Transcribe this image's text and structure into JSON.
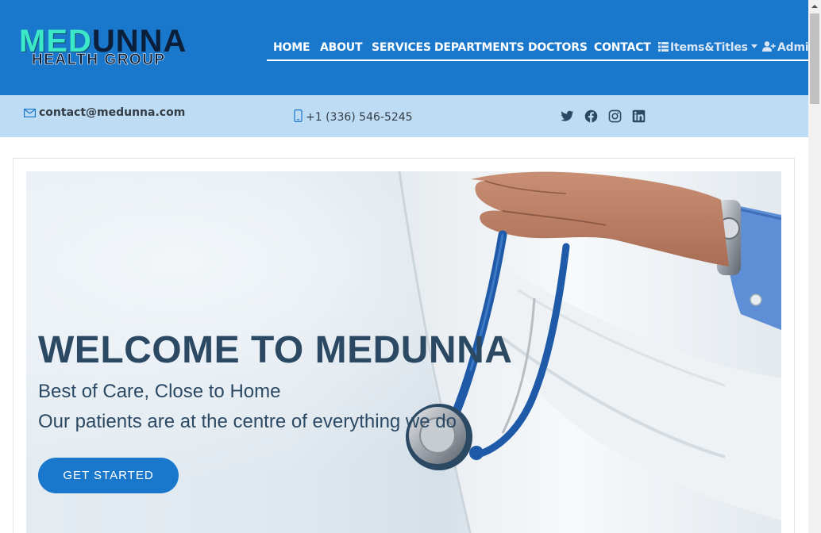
{
  "logo": {
    "line1_a": "MED",
    "line1_b": "UNNA",
    "line2": "HEALTH GROUP"
  },
  "nav": {
    "items": [
      {
        "label": "HOME"
      },
      {
        "label": "ABOUT"
      },
      {
        "label": "SERVICES"
      },
      {
        "label": "DEPARTMENTS"
      },
      {
        "label": "DOCTORS"
      },
      {
        "label": "CONTACT"
      }
    ],
    "dropdown_label": "Items&Titles",
    "dropdown_icon": "list-icon",
    "admin_label": "Admin",
    "admin_icon": "user-plus-icon"
  },
  "topbar": {
    "email": "contact@medunna.com",
    "email_icon": "envelope-icon",
    "phone": "+1 (336) 546-5245",
    "phone_icon": "phone-icon",
    "socials": [
      "twitter-icon",
      "facebook-icon",
      "instagram-icon",
      "linkedin-icon"
    ]
  },
  "hero": {
    "title": "WELCOME TO MEDUNNA",
    "subtitle_1": "Best of Care, Close to Home",
    "subtitle_2": "Our patients are at the centre of everything we do",
    "cta_label": "GET STARTED"
  },
  "colors": {
    "primary": "#1977cc",
    "topbar_bg": "#bfdcf5",
    "heading": "#2c4964",
    "logo_accent": "#3ce8c8",
    "logo_dark": "#0b1e3a"
  }
}
